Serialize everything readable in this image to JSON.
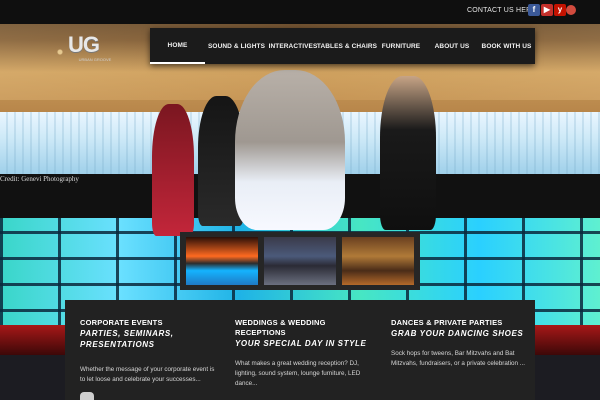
{
  "header": {
    "contact_link": "CONTACT US HERE!",
    "social_icons": [
      "facebook-icon",
      "youtube-icon",
      "yelp-icon",
      "google-plus-icon"
    ],
    "logo_mark": "UG",
    "logo_subtext": "URBAN GROOVE"
  },
  "nav": {
    "items": [
      {
        "label": "HOME",
        "active": true
      },
      {
        "label": "SOUND & LIGHTS"
      },
      {
        "label": "INTERACTIVES"
      },
      {
        "label": "TABLES & CHAIRS"
      },
      {
        "label": "FURNITURE"
      },
      {
        "label": "ABOUT US"
      },
      {
        "label": "BOOK WITH US"
      }
    ]
  },
  "hero": {
    "photo_credit": "Credit: Genevi Photography"
  },
  "services": [
    {
      "title": "CORPORATE EVENTS",
      "tagline": "PARTIES, SEMINARS, PRESENTATIONS",
      "body": "Whether the message of your corporate event is to let loose and celebrate your successes..."
    },
    {
      "title": "WEDDINGS & WEDDING RECEPTIONS",
      "tagline": "YOUR SPECIAL DAY IN STYLE",
      "body": "What makes a great wedding reception? DJ, lighting, sound system, lounge furniture, LED dance..."
    },
    {
      "title": "DANCES & PRIVATE PARTIES",
      "tagline": "GRAB YOUR DANCING SHOES",
      "body": "Sock hops for tweens, Bar Mitzvahs and Bat Mitzvahs, fundraisers, or a private celebration ..."
    }
  ],
  "colors": {
    "nav_bg": "#1b1b1b",
    "panel_bg": "#222222",
    "facebook": "#3b5998",
    "youtube": "#c4302b"
  }
}
